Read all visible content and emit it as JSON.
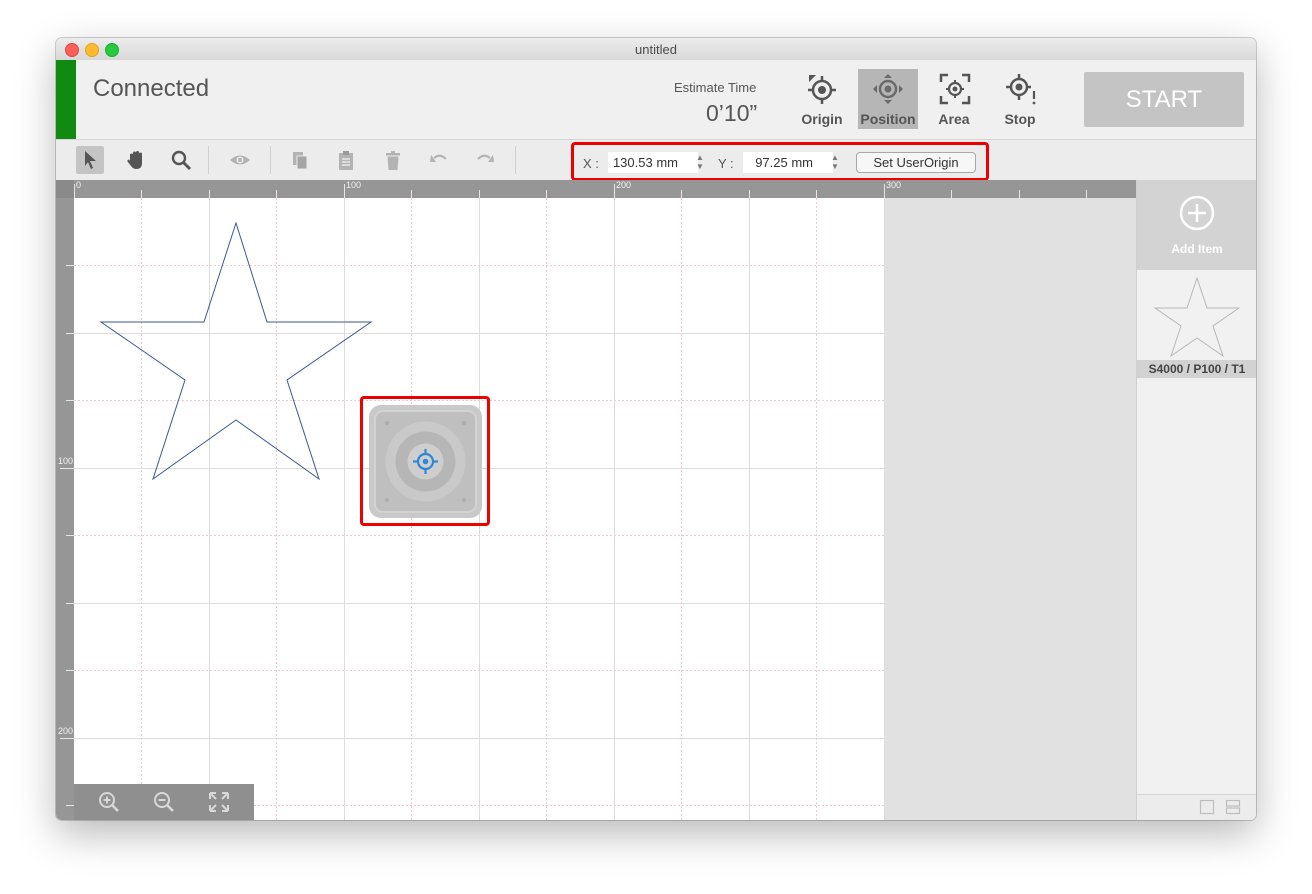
{
  "window": {
    "title": "untitled"
  },
  "header": {
    "status": "Connected",
    "estimate_label": "Estimate Time",
    "estimate_value": "0’10”",
    "buttons": {
      "origin": "Origin",
      "position": "Position",
      "area": "Area",
      "stop": "Stop"
    },
    "start_label": "START"
  },
  "toolbar": {
    "x_label": "X :",
    "x_value": "130.53 mm",
    "y_label": "Y :",
    "y_value": "97.25 mm",
    "set_origin_label": "Set UserOrigin"
  },
  "ruler": {
    "top_labels": [
      "0",
      "100",
      "200",
      "300"
    ],
    "left_labels": [
      "100",
      "200"
    ]
  },
  "panel": {
    "add_item_label": "Add Item",
    "layer_label": "S4000 / P100 / T1"
  },
  "colors": {
    "connected": "#118a12",
    "highlight": "#ec0000",
    "shape_stroke": "#3a5a90",
    "crosshair": "#2f86d6"
  }
}
